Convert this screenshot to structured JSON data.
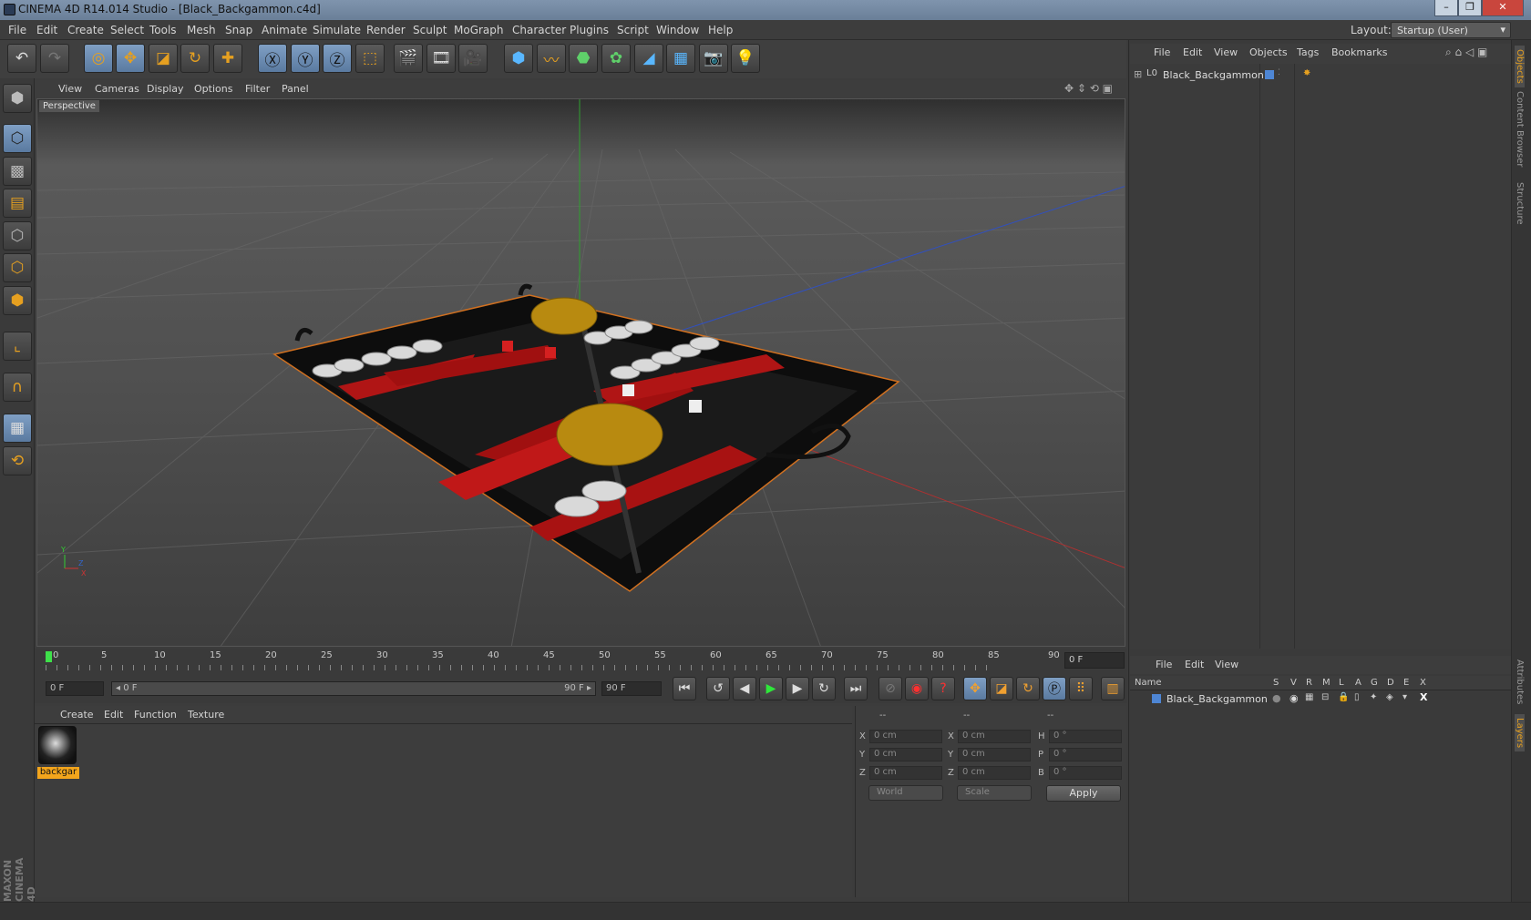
{
  "window": {
    "title": "CINEMA 4D R14.014 Studio - [Black_Backgammon.c4d]",
    "minimize": "–",
    "maximize": "❐",
    "close": "✕"
  },
  "menubar": {
    "items": [
      "File",
      "Edit",
      "Create",
      "Select",
      "Tools",
      "Mesh",
      "Snap",
      "Animate",
      "Simulate",
      "Render",
      "Sculpt",
      "MoGraph",
      "Character",
      "Plugins",
      "Script",
      "Window",
      "Help"
    ],
    "layout_label": "Layout:",
    "layout_value": "Startup (User)"
  },
  "viewport": {
    "menu": [
      "View",
      "Cameras",
      "Display",
      "Options",
      "Filter",
      "Panel"
    ],
    "label": "Perspective",
    "axis": {
      "y": "Y",
      "z": "Z",
      "x": "X"
    }
  },
  "timeline": {
    "ticks": [
      "0",
      "5",
      "10",
      "15",
      "20",
      "25",
      "30",
      "35",
      "40",
      "45",
      "50",
      "55",
      "60",
      "65",
      "70",
      "75",
      "80",
      "85",
      "90"
    ],
    "current_frame": "0 F"
  },
  "transport": {
    "start_field": "0 F",
    "range_start": "◂ 0 F",
    "range_end": "90 F ▸",
    "end_field": "90 F"
  },
  "material_manager": {
    "menu": [
      "Create",
      "Edit",
      "Function",
      "Texture"
    ],
    "materials": [
      {
        "name": "backgar"
      }
    ]
  },
  "coordinates": {
    "headers": [
      "--",
      "--",
      "--"
    ],
    "rows": [
      {
        "l1": "X",
        "v1": "0 cm",
        "l2": "X",
        "v2": "0 cm",
        "l3": "H",
        "v3": "0 °"
      },
      {
        "l1": "Y",
        "v1": "0 cm",
        "l2": "Y",
        "v2": "0 cm",
        "l3": "P",
        "v3": "0 °"
      },
      {
        "l1": "Z",
        "v1": "0 cm",
        "l2": "Z",
        "v2": "0 cm",
        "l3": "B",
        "v3": "0 °"
      }
    ],
    "mode_select": "World",
    "scale_select": "Scale",
    "apply": "Apply"
  },
  "object_manager": {
    "menu": [
      "File",
      "Edit",
      "View",
      "Objects",
      "Tags",
      "Bookmarks"
    ],
    "objects": [
      {
        "name": "Black_Backgammon"
      }
    ]
  },
  "layer_manager": {
    "menu": [
      "File",
      "Edit",
      "View"
    ],
    "columns": [
      "Name",
      "S",
      "V",
      "R",
      "M",
      "L",
      "A",
      "G",
      "D",
      "E",
      "X"
    ],
    "layers": [
      {
        "name": "Black_Backgammon"
      }
    ]
  },
  "side_tabs": [
    "Objects",
    "Content Browser",
    "Structure",
    "Attributes",
    "Layers"
  ],
  "brand": "MAXON CINEMA 4D",
  "colors": {
    "accent": "#e6a020",
    "selected_blue": "#6d8fb8",
    "material_tag": "#f3a51c"
  }
}
